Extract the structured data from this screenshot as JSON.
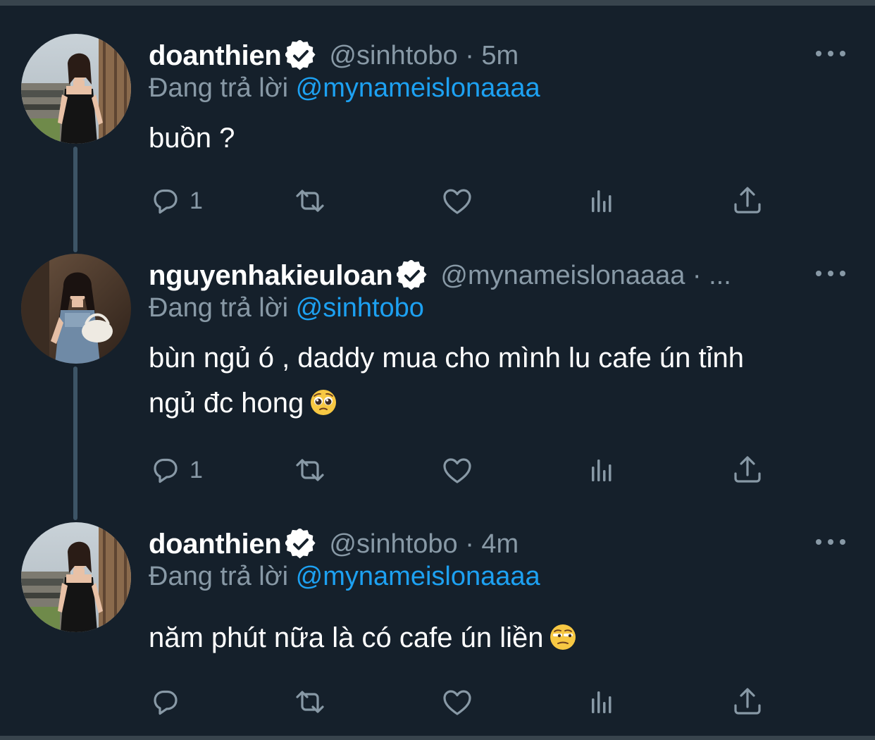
{
  "tweets": [
    {
      "display_name": "doanthien",
      "meta": "@sinhtobo · 5m",
      "reply_prefix": "Đang trả lời ",
      "reply_mention": "@mynameislonaaaa",
      "text": "buồn ?",
      "reply_count": "1"
    },
    {
      "display_name": "nguyenhakieuloan",
      "meta": "@mynameislonaaaa · ...",
      "reply_prefix": "Đang trả lời ",
      "reply_mention": "@sinhtobo",
      "text_line1": "bùn ngủ ó , daddy mua cho mình lu cafe ún tỉnh",
      "text_line2": "ngủ đc hong",
      "reply_count": "1"
    },
    {
      "display_name": "doanthien",
      "meta": "@sinhtobo · 4m",
      "reply_prefix": "Đang trả lời ",
      "reply_mention": "@mynameislonaaaa",
      "text": "năm phút nữa là có cafe ún liền",
      "reply_count": ""
    }
  ],
  "icons": [
    "verified-badge-icon",
    "more-options-icon",
    "reply-icon",
    "retweet-icon",
    "like-icon",
    "analytics-icon",
    "share-icon",
    "pleading-face-emoji",
    "unamused-face-emoji"
  ],
  "colors": {
    "background": "#15202b",
    "text": "#ffffff",
    "secondary": "#8899a6",
    "link": "#1da1f2",
    "thread_line": "#3d5466",
    "divider": "#38444d"
  }
}
